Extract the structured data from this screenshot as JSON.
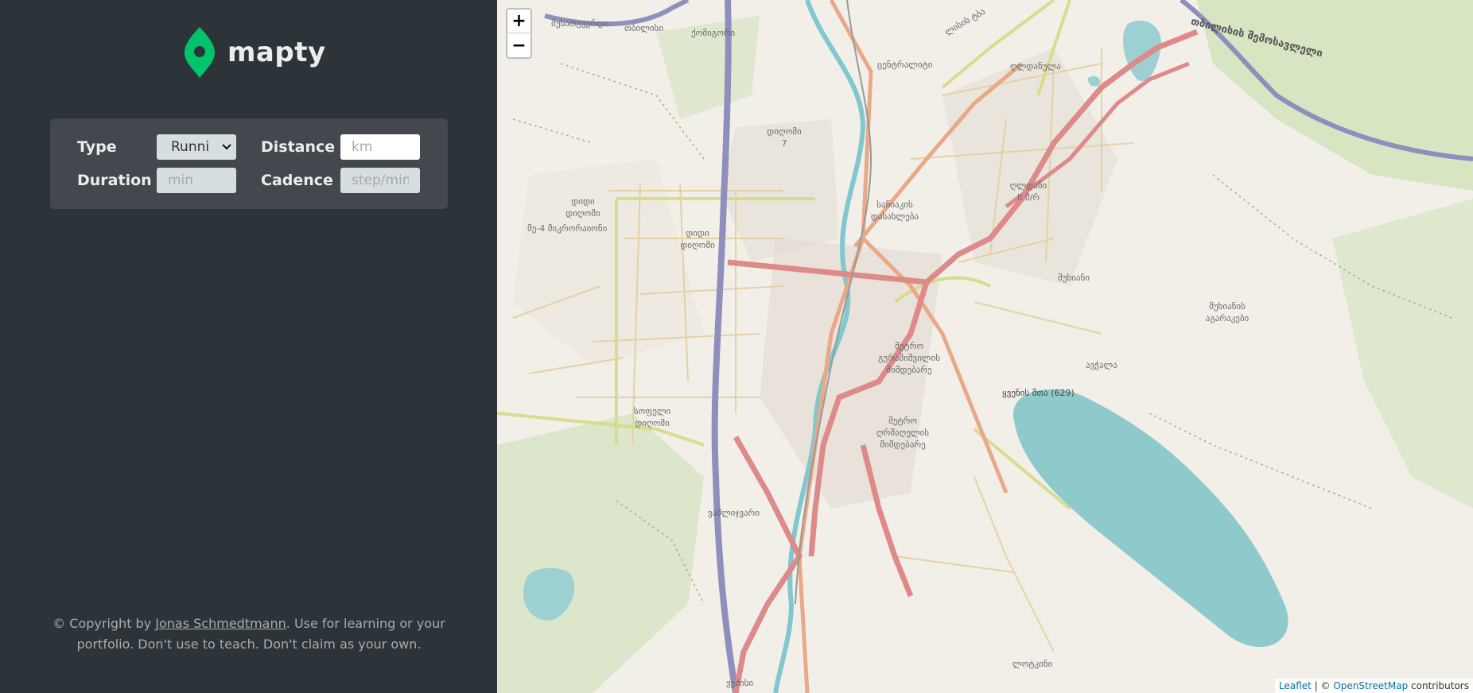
{
  "app": {
    "logo_text": "mapty",
    "brand_color": "#00c46a",
    "sidebar_bg": "#2d3439",
    "form_bg": "#42484d"
  },
  "form": {
    "type_label": "Type",
    "type_value": "Running",
    "type_display": "Runni",
    "distance_label": "Distance",
    "distance_placeholder": "km",
    "duration_label": "Duration",
    "duration_placeholder": "min",
    "cadence_label": "Cadence",
    "cadence_placeholder": "step/min"
  },
  "footer": {
    "prefix": "© Copyright by ",
    "author_link": "Jonas Schmedtmann",
    "suffix": ". Use for learning or your portfolio. Don't use to teach. Don't claim as your own."
  },
  "map": {
    "zoom_in": "+",
    "zoom_out": "−",
    "attribution_leaflet": "Leaflet",
    "attribution_sep": " | © ",
    "attribution_osm": "OpenStreetMap",
    "attribution_suffix": " contributors",
    "labels": [
      "მუხათგვერდი",
      "თბილისი",
      "ქომიგორი",
      "ცენტრალიტი",
      "ღლდანულა",
      "დიღომი 7",
      "ლისის ტბა",
      "თბილისის შემოსავლელი",
      "დიდი დიღომი",
      "მე-4 მიკრორაიონი",
      "დიდი დიღომი",
      "ღლდანი II მ/რ",
      "სანიაკის დასახლება",
      "მუხიანი",
      "მუხიანის აგარაკები",
      "მეტრო გურამიშვილის მიმდებარე",
      "ავჭალა",
      "ყვენის მთა (629)",
      "სოფელი დიღომი",
      "მეტრო ღრმაღელის მიმდებარე",
      "ვაშლიჯვარი",
      "ლოტკინი",
      "ვეძისი"
    ]
  }
}
